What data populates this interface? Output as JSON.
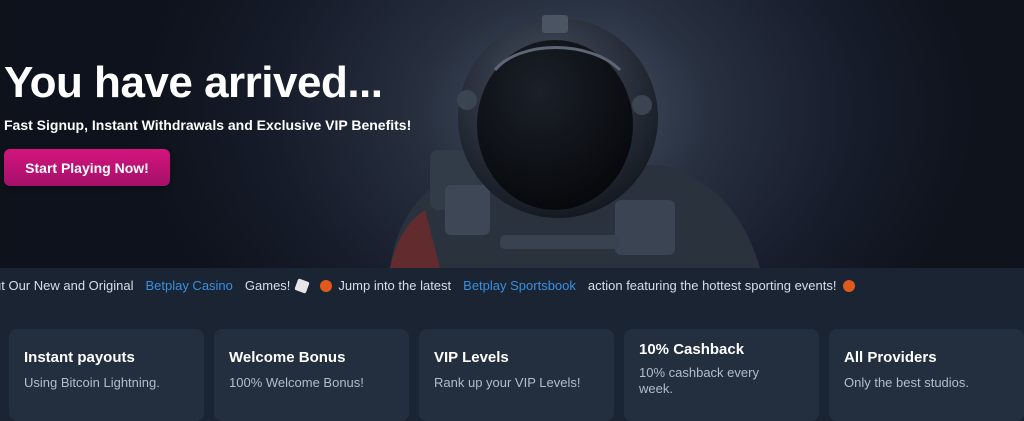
{
  "hero": {
    "title": "You have arrived...",
    "subtitle": "Fast Signup, Instant Withdrawals and Exclusive VIP Benefits!",
    "cta_label": "Start Playing Now!"
  },
  "ticker": {
    "part1": "ut Our New and Original",
    "link1": "Betplay Casino",
    "part2": "Games!",
    "part3": "Jump into the latest",
    "link2": "Betplay Sportsbook",
    "part4": "action featuring the hottest sporting events!"
  },
  "features": [
    {
      "title": "Instant payouts",
      "desc": "Using Bitcoin Lightning."
    },
    {
      "title": "Welcome Bonus",
      "desc": "100% Welcome Bonus!"
    },
    {
      "title": "VIP Levels",
      "desc": "Rank up your VIP Levels!"
    },
    {
      "title": "10% Cashback",
      "desc": "10% cashback every week."
    },
    {
      "title": "All Providers",
      "desc": "Only the best studios."
    }
  ],
  "colors": {
    "accent": "#d4147d",
    "link": "#3a8fe0",
    "background": "#1a2433",
    "card": "#232f3f"
  },
  "icons": [
    "dice-icon",
    "basketball-icon"
  ]
}
